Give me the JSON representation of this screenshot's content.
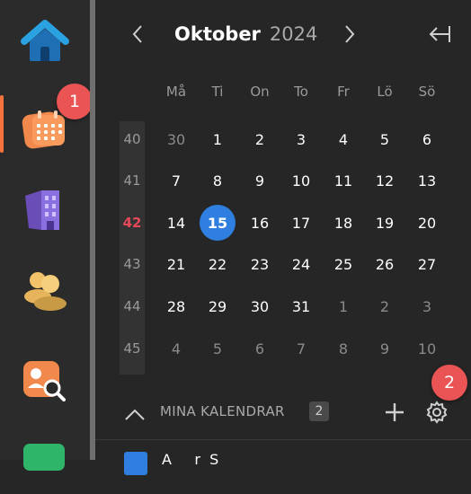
{
  "sidebar": {
    "items": [
      {
        "name": "home"
      },
      {
        "name": "calendar"
      },
      {
        "name": "buildings"
      },
      {
        "name": "people"
      },
      {
        "name": "contact-search"
      },
      {
        "name": "money"
      }
    ],
    "notification_badge": "1"
  },
  "calendar": {
    "month": "Oktober",
    "year": "2024",
    "weekdays": [
      "Må",
      "Ti",
      "On",
      "To",
      "Fr",
      "Lö",
      "Sö"
    ],
    "weeks": [
      {
        "week": "40",
        "days": [
          "30",
          "1",
          "2",
          "3",
          "4",
          "5",
          "6"
        ]
      },
      {
        "week": "41",
        "days": [
          "7",
          "8",
          "9",
          "10",
          "11",
          "12",
          "13"
        ]
      },
      {
        "week": "42",
        "days": [
          "14",
          "15",
          "16",
          "17",
          "18",
          "19",
          "20"
        ]
      },
      {
        "week": "43",
        "days": [
          "21",
          "22",
          "23",
          "24",
          "25",
          "26",
          "27"
        ]
      },
      {
        "week": "44",
        "days": [
          "28",
          "29",
          "30",
          "31",
          "1",
          "2",
          "3"
        ]
      },
      {
        "week": "45",
        "days": [
          "4",
          "5",
          "6",
          "7",
          "8",
          "9",
          "10"
        ]
      }
    ],
    "today": "15",
    "current_week": "42"
  },
  "my_calendars": {
    "label": "MINA KALENDRAR",
    "count": "2",
    "settings_badge": "2",
    "first_item_partial": "A     r  S"
  },
  "colors": {
    "accent_today": "#2f7fe0",
    "current_week": "#e8475a",
    "badge": "#ea5454",
    "active_indicator": "#f5733c"
  }
}
